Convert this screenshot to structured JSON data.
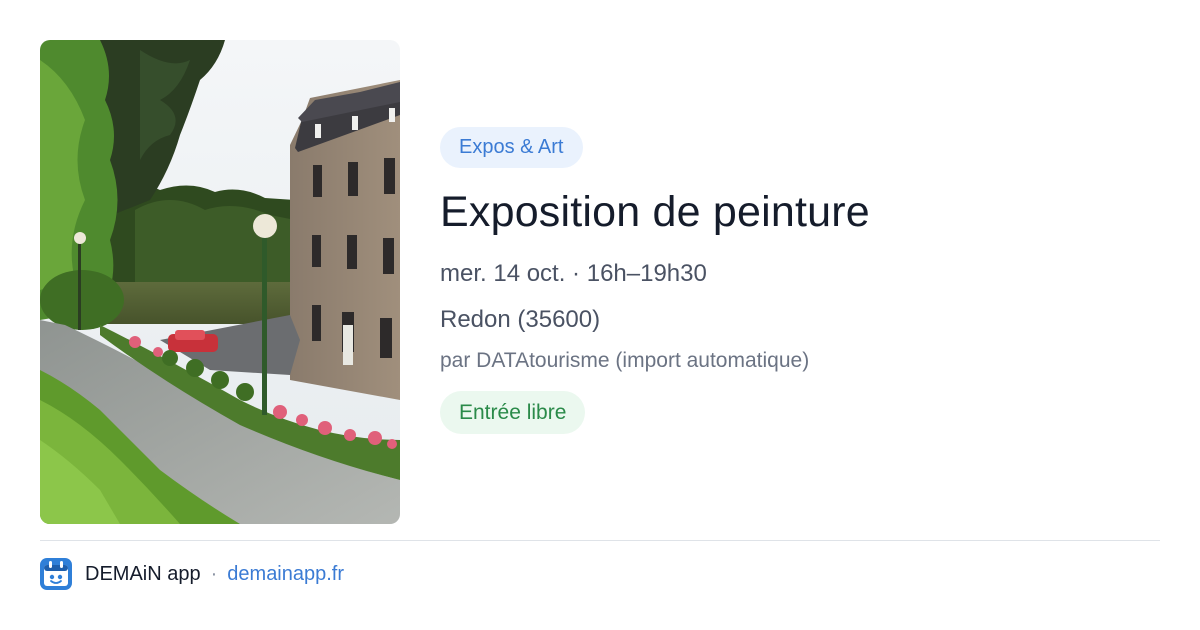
{
  "event": {
    "category": "Expos & Art",
    "title": "Exposition de peinture",
    "when": "mer. 14 oct. · 16h–19h30",
    "where": "Redon (35600)",
    "organizer": "par DATAtourisme (import automatique)",
    "price": "Entrée libre"
  },
  "footer": {
    "app_name": "DEMAiN app",
    "separator": "·",
    "site": "demainapp.fr"
  },
  "colors": {
    "category_bg": "#eaf2fd",
    "category_text": "#3b7bd4",
    "price_bg": "#ebf8ef",
    "price_text": "#2a8a49",
    "link": "#3b7bd4"
  },
  "icons": {
    "app_logo": "calendar-app-icon"
  }
}
